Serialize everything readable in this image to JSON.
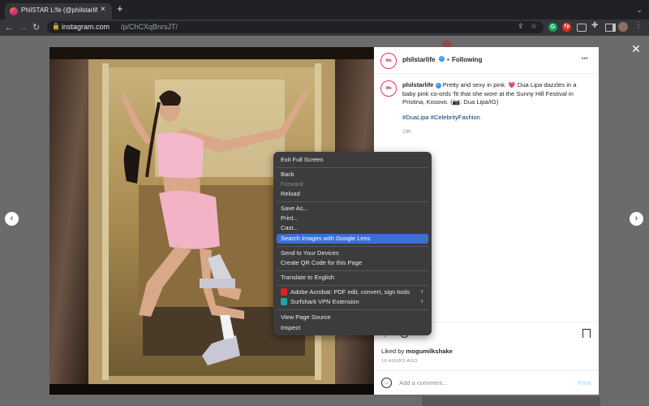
{
  "browser": {
    "tab_title": "PhilSTAR L!fe (@philstarlife) • ",
    "tab_close": "×",
    "new_tab": "+",
    "url_host": "instagram.com",
    "url_path": "/p/ChCXqBnrsJT/",
    "ext_badges": [
      "G",
      "Tp"
    ]
  },
  "post": {
    "account": "philstarlife",
    "follow_sep": "•",
    "following": "Following",
    "more": "•••",
    "avatar_text": "life",
    "caption_user": "philstarlife",
    "caption_text": "Pretty and sexy in pink. 💗 Dua Lipa dazzles in a baby pink co-ords 'fit that she wore at the Sunny Hill Festival in Pristina, Kosovo. (📷: Dua Lipa/IG)",
    "hashtags": "#DuaLipa #CelebrityFashion",
    "caption_age": "19h",
    "liked_by_prefix": "Liked by",
    "liked_by_user": "mogumilkshake",
    "post_age": "19 HOURS AGO",
    "comment_placeholder": "Add a comment...",
    "post_button": "Post"
  },
  "context_menu": {
    "items": [
      "Exit Full Screen",
      "Back",
      "Forward",
      "Reload",
      "Save As...",
      "Print...",
      "Cast...",
      "Search Images with Google Lens",
      "Send to Your Devices",
      "Create QR Code for this Page",
      "Translate to English",
      "Adobe Acrobat: PDF edit, convert, sign tools",
      "Surfshark VPN Extension",
      "View Page Source",
      "Inspect"
    ],
    "disabled_item": "Forward",
    "highlighted_item": "Search Images with Google Lens"
  },
  "colors": {
    "accent": "#0095f6",
    "highlight": "#3b6fd6",
    "verified": "#3897f0"
  }
}
